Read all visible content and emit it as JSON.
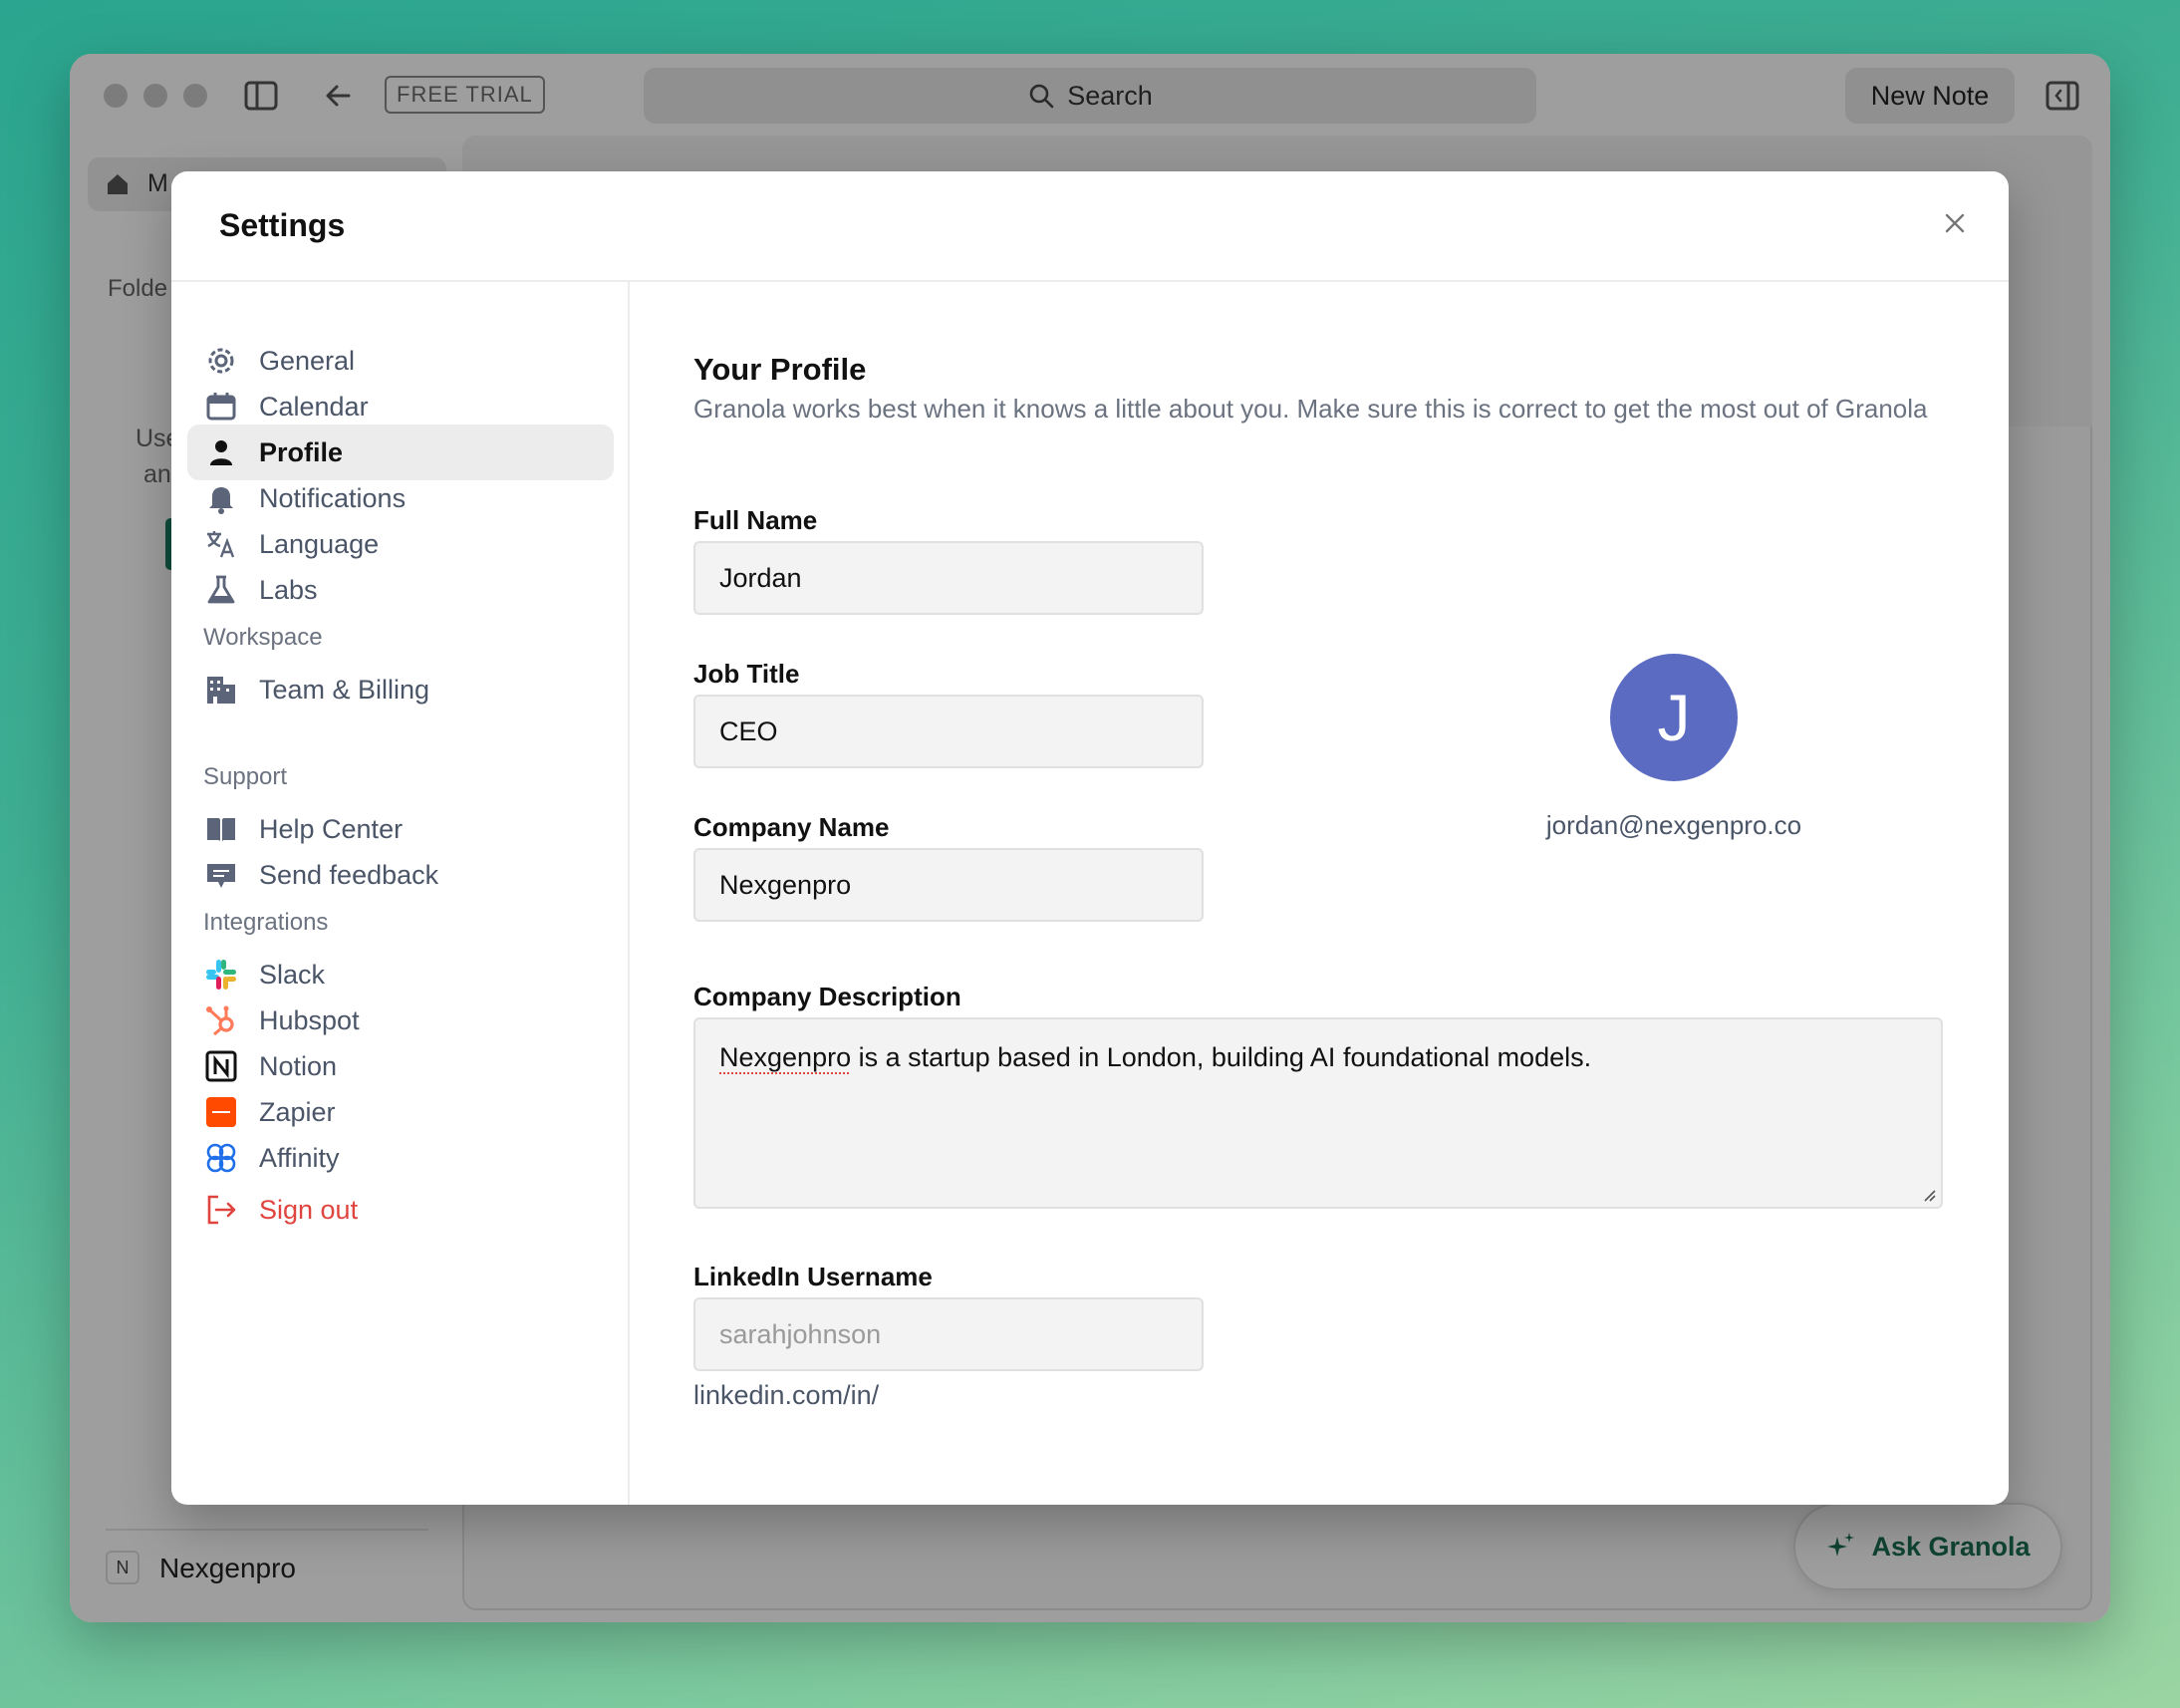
{
  "window": {
    "free_trial": "FREE TRIAL",
    "search_label": "Search",
    "new_note": "New Note",
    "bg_home_label": "M",
    "bg_folders": "Folde",
    "bg_use1": "Use",
    "bg_use2": "an",
    "workspace_badge": "N",
    "workspace_name": "Nexgenpro",
    "ask_granola": "Ask Granola"
  },
  "modal": {
    "title": "Settings",
    "nav": {
      "items": [
        {
          "label": "General",
          "icon": "gear-icon"
        },
        {
          "label": "Calendar",
          "icon": "calendar-icon"
        },
        {
          "label": "Profile",
          "icon": "person-icon",
          "active": true
        },
        {
          "label": "Notifications",
          "icon": "bell-icon"
        },
        {
          "label": "Language",
          "icon": "translate-icon"
        },
        {
          "label": "Labs",
          "icon": "flask-icon"
        }
      ],
      "workspace_heading": "Workspace",
      "workspace_items": [
        {
          "label": "Team & Billing",
          "icon": "building-icon"
        }
      ],
      "support_heading": "Support",
      "support_items": [
        {
          "label": "Help Center",
          "icon": "book-icon"
        },
        {
          "label": "Send feedback",
          "icon": "chat-icon"
        }
      ],
      "integrations_heading": "Integrations",
      "integration_items": [
        {
          "label": "Slack",
          "icon": "slack-icon"
        },
        {
          "label": "Hubspot",
          "icon": "hubspot-icon"
        },
        {
          "label": "Notion",
          "icon": "notion-icon"
        },
        {
          "label": "Zapier",
          "icon": "zapier-icon"
        },
        {
          "label": "Affinity",
          "icon": "affinity-icon"
        }
      ],
      "sign_out": "Sign out"
    },
    "profile": {
      "heading": "Your Profile",
      "subtitle": "Granola works best when it knows a little about you. Make sure this is correct to get the most out of Granola",
      "full_name_label": "Full Name",
      "full_name": "Jordan",
      "job_title_label": "Job Title",
      "job_title": "CEO",
      "company_name_label": "Company Name",
      "company_name": "Nexgenpro",
      "company_description_label": "Company Description",
      "company_description_first_word": "Nexgenpro",
      "company_description_rest": " is a startup based in London, building AI foundational models.",
      "linkedin_label": "LinkedIn Username",
      "linkedin_placeholder": "sarahjohnson",
      "linkedin_hint": "linkedin.com/in/",
      "avatar_initial": "J",
      "email": "jordan@nexgenpro.co"
    }
  },
  "colors": {
    "accent_avatar": "#5b6bc2",
    "danger": "#e0443e",
    "brand_green": "#1a6e52"
  }
}
